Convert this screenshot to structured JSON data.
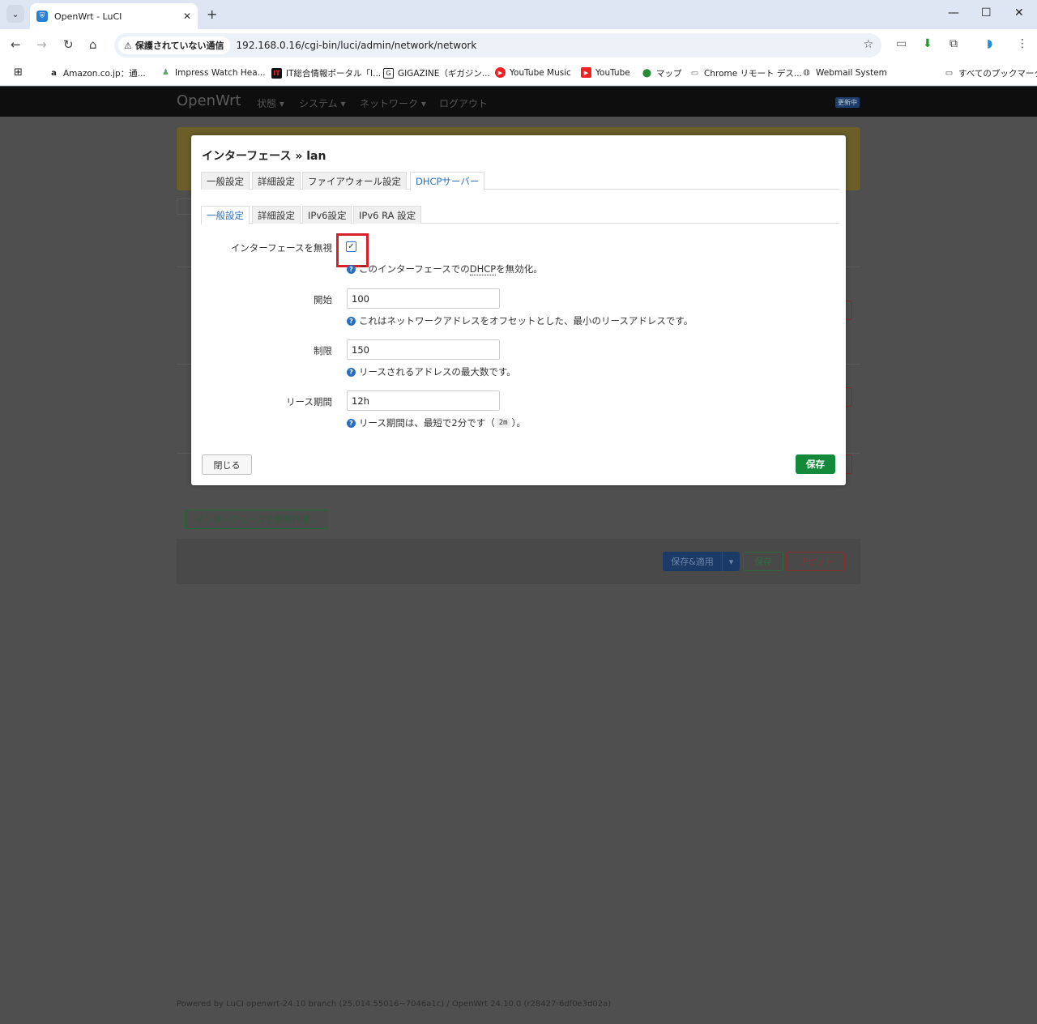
{
  "browser": {
    "tab_title": "OpenWrt - LuCI",
    "security_label": "保護されていない通信",
    "url": "192.168.0.16/cgi-bin/luci/admin/network/network",
    "bookmarks": [
      "Amazon.co.jp：通...",
      "Impress Watch Hea...",
      "IT総合情報ポータル「I...",
      "GIGAZINE（ギガジン...",
      "YouTube Music",
      "YouTube",
      "マップ",
      "Chrome リモート デス...",
      "Webmail System"
    ],
    "all_bookmarks": "すべてのブックマーク"
  },
  "luci": {
    "brand": "OpenWrt",
    "menu": [
      "状態 ▾",
      "システム ▾",
      "ネットワーク ▾",
      "ログアウト"
    ],
    "updating_badge": "更新中",
    "add_interface": "インターフェースを新規作成...",
    "save_apply": "保存&適用",
    "save": "保存",
    "reset": "リセット",
    "footer": "Powered by LuCI openwrt-24.10 branch (25.014.55016~7046a1c) / OpenWrt 24.10.0 (r28427-6df0e3d02a)"
  },
  "modal": {
    "title": "インターフェース » lan",
    "main_tabs": [
      "一般設定",
      "詳細設定",
      "ファイアウォール設定",
      "DHCPサーバー"
    ],
    "sub_tabs": [
      "一般設定",
      "詳細設定",
      "IPv6設定",
      "IPv6 RA 設定"
    ],
    "ignore": {
      "label": "インターフェースを無視",
      "hint_pre": "このインターフェースでの",
      "hint_abbr": "DHCP",
      "hint_post": "を無効化。",
      "checked": true
    },
    "start": {
      "label": "開始",
      "value": "100",
      "hint": "これはネットワークアドレスをオフセットとした、最小のリースアドレスです。"
    },
    "limit": {
      "label": "制限",
      "value": "150",
      "hint": "リースされるアドレスの最大数です。"
    },
    "leasetime": {
      "label": "リース期間",
      "value": "12h",
      "hint_pre": "リース期間は、最短で2分です（",
      "hint_code": "2m",
      "hint_post": "）。"
    },
    "close_button": "閉じる",
    "save_button": "保存"
  }
}
